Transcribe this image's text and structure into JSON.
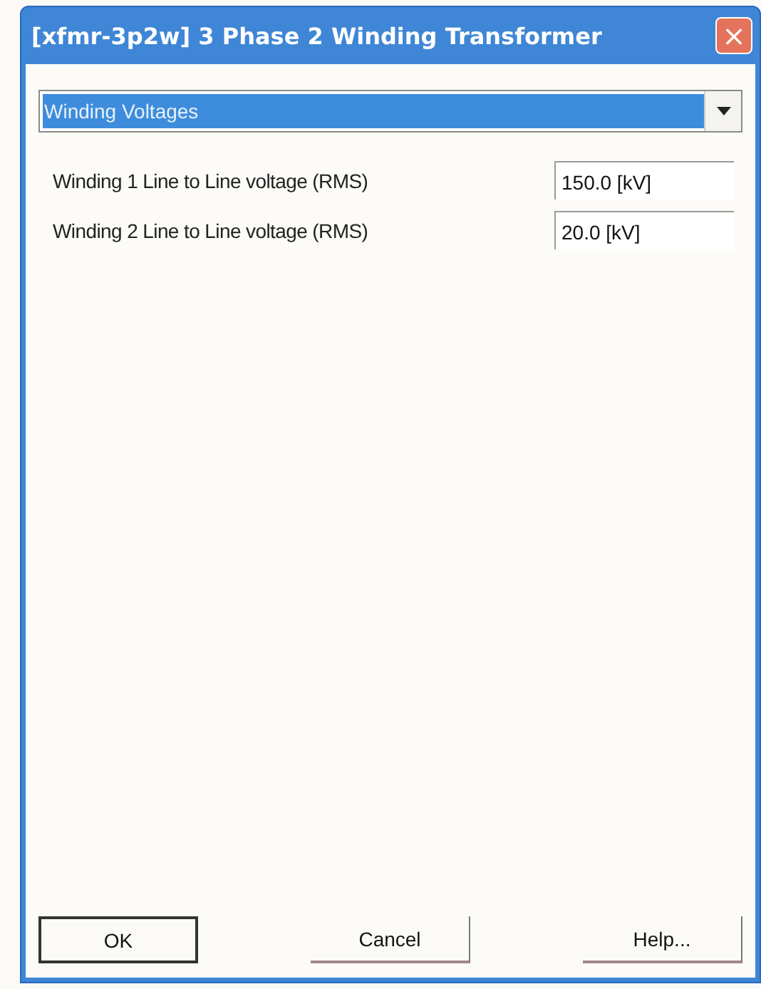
{
  "window": {
    "title": "[xfmr-3p2w] 3 Phase 2 Winding Transformer",
    "close": "×"
  },
  "category": {
    "value": "Winding Voltages"
  },
  "fields": [
    {
      "label": "Winding 1 Line to Line voltage (RMS)",
      "value": "150.0 [kV]"
    },
    {
      "label": "Winding 2 Line to Line voltage (RMS)",
      "value": "20.0 [kV]"
    }
  ],
  "buttons": [
    {
      "label": "OK",
      "default": true
    },
    {
      "label": "Cancel",
      "default": false
    },
    {
      "label": "Help...",
      "default": false
    }
  ]
}
